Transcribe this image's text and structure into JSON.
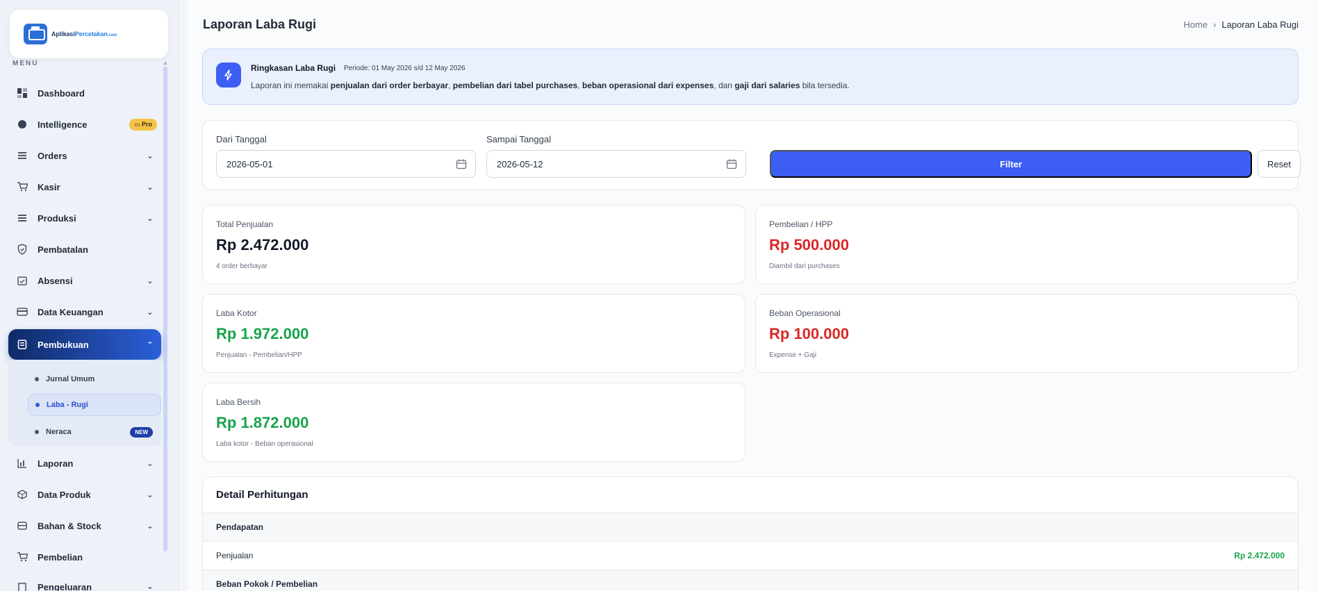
{
  "sidebar": {
    "logo": {
      "name": "Aplikasi",
      "accent": "Percetakan",
      "suffix": ".com"
    },
    "menu_label": "MENU",
    "items": [
      {
        "label": "Dashboard",
        "icon": "dashboard-icon"
      },
      {
        "label": "Intelligence",
        "icon": "brain-icon",
        "badge": "Pro"
      },
      {
        "label": "Orders",
        "icon": "list-icon"
      },
      {
        "label": "Kasir",
        "icon": "cart-icon"
      },
      {
        "label": "Produksi",
        "icon": "list-icon"
      },
      {
        "label": "Pembatalan",
        "icon": "shield-icon"
      },
      {
        "label": "Absensi",
        "icon": "calendar-check-icon"
      },
      {
        "label": "Data Keuangan",
        "icon": "wallet-icon"
      },
      {
        "label": "Pembukuan",
        "icon": "book-icon"
      },
      {
        "label": "Laporan",
        "icon": "bar-chart-icon"
      },
      {
        "label": "Data Produk",
        "icon": "box-icon"
      },
      {
        "label": "Bahan & Stock",
        "icon": "database-icon"
      },
      {
        "label": "Pembelian",
        "icon": "cart-icon"
      },
      {
        "label": "Pengeluaran",
        "icon": "receipt-icon"
      }
    ],
    "submenu": [
      {
        "label": "Jurnal Umum"
      },
      {
        "label": "Laba - Rugi"
      },
      {
        "label": "Neraca",
        "badge": "NEW"
      }
    ]
  },
  "header": {
    "title": "Laporan Laba Rugi",
    "breadcrumb": {
      "home": "Home",
      "current": "Laporan Laba Rugi"
    }
  },
  "summary": {
    "title": "Ringkasan Laba Rugi",
    "period": "Periode: 01 May 2026 s/d 12 May 2026",
    "desc_1": "Laporan ini memakai ",
    "desc_b1": "penjualan dari order berbayar",
    "desc_2": ", ",
    "desc_b2": "pembelian dari tabel purchases",
    "desc_3": ", ",
    "desc_b3": "beban operasional dari expenses",
    "desc_4": ", dan ",
    "desc_b4": "gaji dari salaries",
    "desc_5": " bila tersedia."
  },
  "filter": {
    "from_label": "Dari Tanggal",
    "from_value": "2026-05-01",
    "to_label": "Sampai Tanggal",
    "to_value": "2026-05-12",
    "filter_label": "Filter",
    "reset_label": "Reset"
  },
  "stats": {
    "total_penjualan": {
      "label": "Total Penjualan",
      "value": "Rp 2.472.000",
      "sub": "4 order berbayar"
    },
    "pembelian": {
      "label": "Pembelian / HPP",
      "value": "Rp 500.000",
      "sub": "Diambil dari purchases"
    },
    "laba_kotor": {
      "label": "Laba Kotor",
      "value": "Rp 1.972.000",
      "sub": "Penjualan - Pembelian/HPP"
    },
    "beban": {
      "label": "Beban Operasional",
      "value": "Rp 100.000",
      "sub": "Expense + Gaji"
    },
    "laba_bersih": {
      "label": "Laba Bersih",
      "value": "Rp 1.872.000",
      "sub": "Laba kotor - Beban operasional"
    }
  },
  "detail": {
    "title": "Detail Perhitungan",
    "section_pendapatan": "Pendapatan",
    "row_penjualan_label": "Penjualan",
    "row_penjualan_value": "Rp 2.472.000",
    "section_beban": "Beban Pokok / Pembelian"
  },
  "colors": {
    "primary": "#3d5ef3",
    "red": "#dc2626",
    "green": "#16a34a",
    "active_nav_start": "#0f2a66",
    "active_nav_end": "#2b5fd8"
  }
}
